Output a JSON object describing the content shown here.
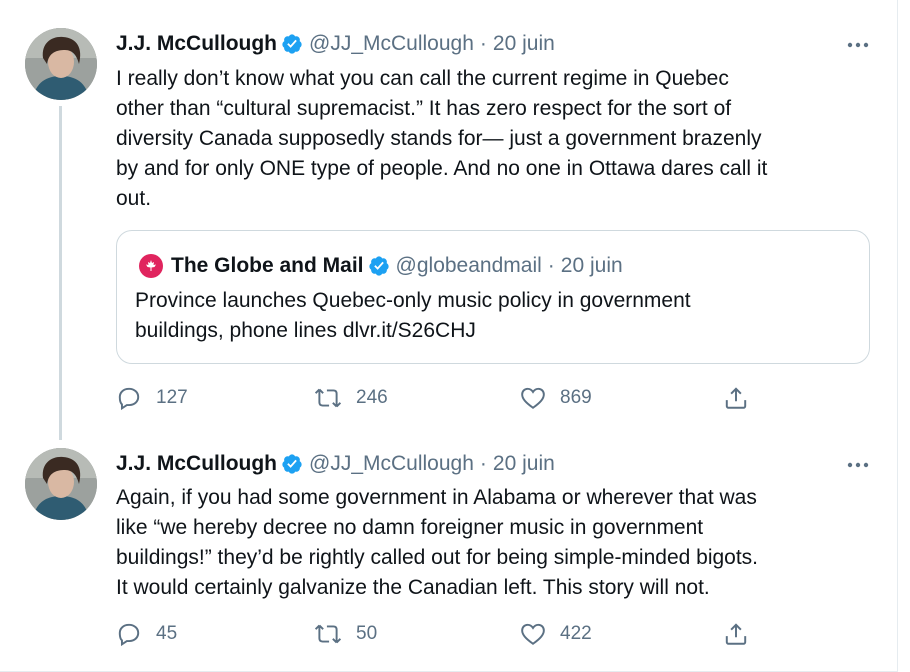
{
  "tweets": [
    {
      "author_name": "J.J. McCullough",
      "handle": "@JJ_McCullough",
      "separator": "·",
      "date": "20 juin",
      "text": "I really don’t know what you can call the current regime in Quebec\nother than “cultural supremacist.” It has zero respect for the sort of\ndiversity Canada supposedly stands for— just a government brazenly\nby and for only ONE type of people. And no one in Ottawa dares call it\nout.",
      "quote": {
        "author_name": "The Globe and Mail",
        "handle": "@globeandmail",
        "separator": "·",
        "date": "20 juin",
        "text": "Province launches Quebec-only music policy in government\nbuildings, phone lines dlvr.it/S26CHJ"
      },
      "replies": "127",
      "retweets": "246",
      "likes": "869"
    },
    {
      "author_name": "J.J. McCullough",
      "handle": "@JJ_McCullough",
      "separator": "·",
      "date": "20 juin",
      "text": "Again, if you had some government in Alabama or wherever that was\nlike “we hereby decree no damn foreigner music in government\nbuildings!” they’d be rightly called out for being simple-minded bigots.\nIt would certainly galvanize the Canadian left. This story will not.",
      "replies": "45",
      "retweets": "50",
      "likes": "422"
    }
  ],
  "icons": {
    "verified": "verified-badge-icon",
    "more": "more-horizontal-icon",
    "reply": "reply-icon",
    "retweet": "retweet-icon",
    "like": "heart-icon",
    "share": "share-icon",
    "quote_logo": "maple-leaf-icon"
  },
  "colors": {
    "verified": "#1da1f2",
    "secondary_text": "#5b7083",
    "quote_logo_bg": "#e0245e",
    "border": "#cfd9de"
  }
}
